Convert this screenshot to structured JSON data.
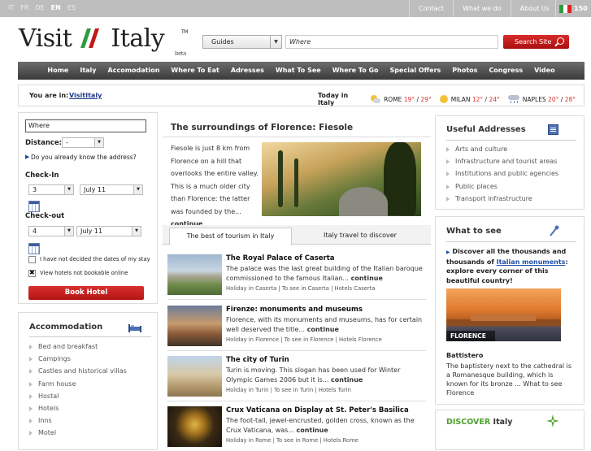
{
  "languages": [
    "IT",
    "FR",
    "DE",
    "EN",
    "ES"
  ],
  "active_language": "EN",
  "top_links": [
    "Contact",
    "What we do",
    "About Us"
  ],
  "flag_count": "150",
  "logo": {
    "word1": "Visit",
    "word2": "Italy",
    "tm": "TM",
    "beta": "beta"
  },
  "search": {
    "category": "Guides",
    "placeholder": "Where",
    "button": "Search Site"
  },
  "nav": [
    "Home",
    "Italy",
    "Accomodation",
    "Where To Eat",
    "Adresses",
    "What To See",
    "Where To Go",
    "Special Offers",
    "Photos",
    "Congress",
    "Video"
  ],
  "crumb": {
    "label": "You are in:",
    "link": "VisitItaly"
  },
  "weather": {
    "today": "Today in Italy",
    "cities": [
      {
        "name": "ROME",
        "lo": "19°",
        "hi": "29°",
        "icon": "partly-sunny-icon"
      },
      {
        "name": "MILAN",
        "lo": "12°",
        "hi": "24°",
        "icon": "sun-icon"
      },
      {
        "name": "NAPLES",
        "lo": "20°",
        "hi": "28°",
        "icon": "rain-icon"
      }
    ]
  },
  "booking": {
    "where": "Where",
    "distance_label": "Distance:",
    "distance_value": "-",
    "know_address": "Do you already know the address?",
    "checkin_label": "Check-In",
    "checkin_day": "3",
    "checkin_month": "July 11",
    "checkout_label": "Check-out",
    "checkout_day": "4",
    "checkout_month": "July 11",
    "undecided": "I have not decided the dates of my stay",
    "view_not_bookable": "View hotels not bookable online",
    "button": "Book Hotel"
  },
  "accommodation": {
    "title": "Accommodation",
    "items": [
      "Bed and breakfast",
      "Campings",
      "Castles and historical villas",
      "Farm house",
      "Hostal",
      "Hotels",
      "Inns",
      "Motel"
    ]
  },
  "featured": {
    "title": "The surroundings of Florence: Fiesole",
    "text": "Fiesole is just 8 km from Florence on a hill that overlooks the entire valley. This is a much older city than Florence: the latter was founded by the...",
    "more": "continue"
  },
  "tabs": [
    "The best of tourism in Italy",
    "Italy travel to discover"
  ],
  "articles": [
    {
      "title": "The Royal Palace of Caserta",
      "text": "The palace was the last great building of the Italian baroque commissioned to the famous Italian...",
      "more": "continue",
      "tags": "Holiday in Caserta | To see in Caserta | Hotels Caserta"
    },
    {
      "title": "Firenze: monuments and museums",
      "text": "Florence, with its monuments and museums, has for certain well deserved the title...",
      "more": "continue",
      "tags": "Holiday in Florence | To see in Florence | Hotels Florence"
    },
    {
      "title": "The city of Turin",
      "text": "Turin is moving. This slogan has been used for Winter Olympic Games 2006 but it is...",
      "more": "continue",
      "tags": "Holiday in Turin | To see in Turin | Hotels Turin"
    },
    {
      "title": "Crux Vaticana on Display at St. Peter's Basilica",
      "text": "The foot-tall, jewel-encrusted, golden cross, known as the Crux Vaticana, was...",
      "more": "continue",
      "tags": "Holiday in Rome | To see in Rome | Hotels Rome"
    }
  ],
  "useful": {
    "title": "Useful Addresses",
    "items": [
      "Arts and culture",
      "Infrastructure and tourist areas",
      "Institutions and public agencies",
      "Public places",
      "Transport infrastructure"
    ]
  },
  "what_to_see": {
    "title": "What to see",
    "lead_before": "Discover all the thousands and thousands of ",
    "lead_link": "Italian monuments",
    "lead_after": ": explore every corner of this beautiful country!",
    "image_label": "FLORENCE",
    "name": "Battistero",
    "desc": "The baptistery next to the cathedral is a Romanesque building, which is known for its bronze ... What to see Florence"
  },
  "discover": {
    "word1": "DISCOVER",
    "word2": "Italy"
  },
  "colors": {
    "accent_red": "#c11a1a",
    "nav_dark": "#4a4a4a",
    "link_blue": "#1f4fa8",
    "green": "#4ca12e"
  }
}
